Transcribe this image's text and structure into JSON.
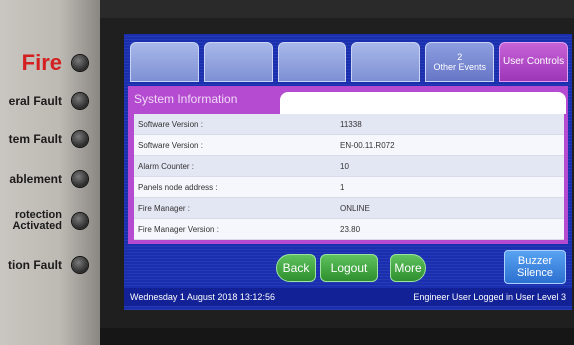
{
  "indicators": [
    {
      "label": "Fire",
      "style": "fire"
    },
    {
      "label": "eral Fault"
    },
    {
      "label": "tem Fault"
    },
    {
      "label": "ablement"
    },
    {
      "label": "rotection Activated",
      "two_line": true
    },
    {
      "label": "tion Fault"
    }
  ],
  "tabs": {
    "t1": "",
    "t2": "",
    "t3": "",
    "t4": "",
    "other_count": "2",
    "other_label": "Other Events",
    "user_controls": "User Controls"
  },
  "system_info": {
    "title": "System Information",
    "rows": [
      {
        "key": "Software Version :",
        "value": "11338"
      },
      {
        "key": "Software Version :",
        "value": "EN-00.11.R072"
      },
      {
        "key": "Alarm Counter :",
        "value": "10"
      },
      {
        "key": "Panels node address :",
        "value": "1"
      },
      {
        "key": "Fire Manager :",
        "value": "ONLINE"
      },
      {
        "key": "Fire Manager Version :",
        "value": "23.80"
      }
    ]
  },
  "buttons": {
    "back": "Back",
    "logout": "Logout",
    "more": "More",
    "buzzer_line1": "Buzzer",
    "buzzer_line2": "Silence"
  },
  "status": {
    "datetime": "Wednesday 1 August 2018 13:12:56",
    "user": "Engineer User Logged in User Level 3"
  },
  "colors": {
    "screen_blue": "#1a2fb0",
    "accent_purple": "#b44bd0",
    "button_green": "#2d8f2d",
    "buzzer_blue": "#2c70d0",
    "fire_red": "#d42020"
  }
}
